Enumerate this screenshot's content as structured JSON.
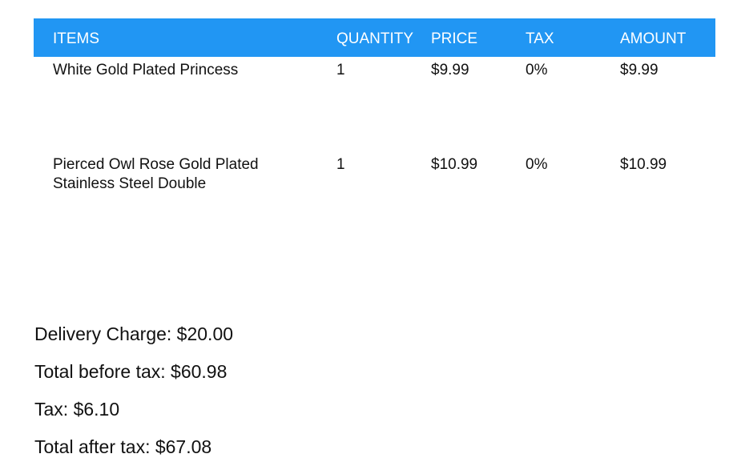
{
  "table": {
    "headers": {
      "items": "ITEMS",
      "quantity": "QUANTITY",
      "price": "PRICE",
      "tax": "TAX",
      "amount": "AMOUNT"
    },
    "rows": [
      {
        "item": "White Gold Plated Princess",
        "quantity": "1",
        "price": "$9.99",
        "tax": "0%",
        "amount": "$9.99"
      },
      {
        "item": "Pierced Owl Rose Gold Plated Stainless Steel Double",
        "quantity": "1",
        "price": "$10.99",
        "tax": "0%",
        "amount": "$10.99"
      }
    ]
  },
  "summary": {
    "delivery_charge": "Delivery Charge: $20.00",
    "total_before_tax": "Total before tax: $60.98",
    "tax": "Tax: $6.10",
    "total_after_tax": "Total after tax: $67.08"
  },
  "colors": {
    "header_background": "#2196f3",
    "header_text": "#ffffff",
    "body_text": "#111111"
  }
}
